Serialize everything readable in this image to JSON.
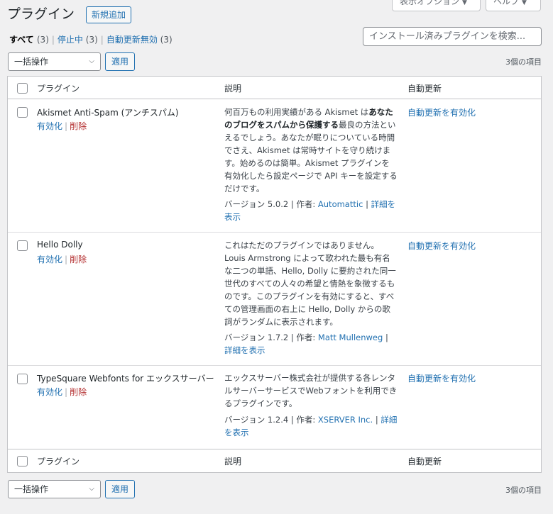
{
  "screen_meta": {
    "screen_options": "表示オプション",
    "help": "ヘルプ"
  },
  "header": {
    "title": "プラグイン",
    "add_new": "新規追加"
  },
  "filters": {
    "all_label": "すべて",
    "all_count": "(3)",
    "inactive_label": "停止中",
    "inactive_count": "(3)",
    "autoupdate_label": "自動更新無効",
    "autoupdate_count": "(3)",
    "separator": "|"
  },
  "search": {
    "placeholder": "インストール済みプラグインを検索..."
  },
  "bulk": {
    "label": "一括操作",
    "apply": "適用",
    "items_count": "3個の項目"
  },
  "columns": {
    "plugin": "プラグイン",
    "description": "説明",
    "auto_update": "自動更新"
  },
  "plugins": [
    {
      "name": "Akismet Anti-Spam (アンチスパム)",
      "activate": "有効化",
      "delete": "削除",
      "desc_pre": "何百万もの利用実績がある Akismet は",
      "desc_bold": "あなたのブログをスパムから保護する",
      "desc_post": "最良の方法といえるでしょう。あなたが眠りについている時間でさえ、Akismet は常時サイトを守り続けます。始めるのは簡単。Akismet プラグインを有効化したら設定ページで API キーを設定するだけです。",
      "version": "バージョン 5.0.2",
      "by": "作者:",
      "author": "Automattic",
      "details": "詳細を表示",
      "auto_update": "自動更新を有効化"
    },
    {
      "name": "Hello Dolly",
      "activate": "有効化",
      "delete": "削除",
      "desc_pre": "これはただのプラグインではありません。Louis Armstrong によって歌われた最も有名な二つの単語、Hello, Dolly に要約された同一世代のすべての人々の希望と情熱を象徴するものです。このプラグインを有効にすると、すべての管理画面の右上に Hello, Dolly からの歌詞がランダムに表示されます。",
      "desc_bold": "",
      "desc_post": "",
      "version": "バージョン 1.7.2",
      "by": "作者:",
      "author": "Matt Mullenweg",
      "details": "詳細を表示",
      "auto_update": "自動更新を有効化"
    },
    {
      "name": "TypeSquare Webfonts for エックスサーバー",
      "activate": "有効化",
      "delete": "削除",
      "desc_pre": "エックスサーバー株式会社が提供する各レンタルサーバーサービスでWebフォントを利用できるプラグインです。",
      "desc_bold": "",
      "desc_post": "",
      "version": "バージョン 1.2.4",
      "by": "作者:",
      "author": "XSERVER Inc.",
      "details": "詳細を表示",
      "auto_update": "自動更新を有効化"
    }
  ]
}
